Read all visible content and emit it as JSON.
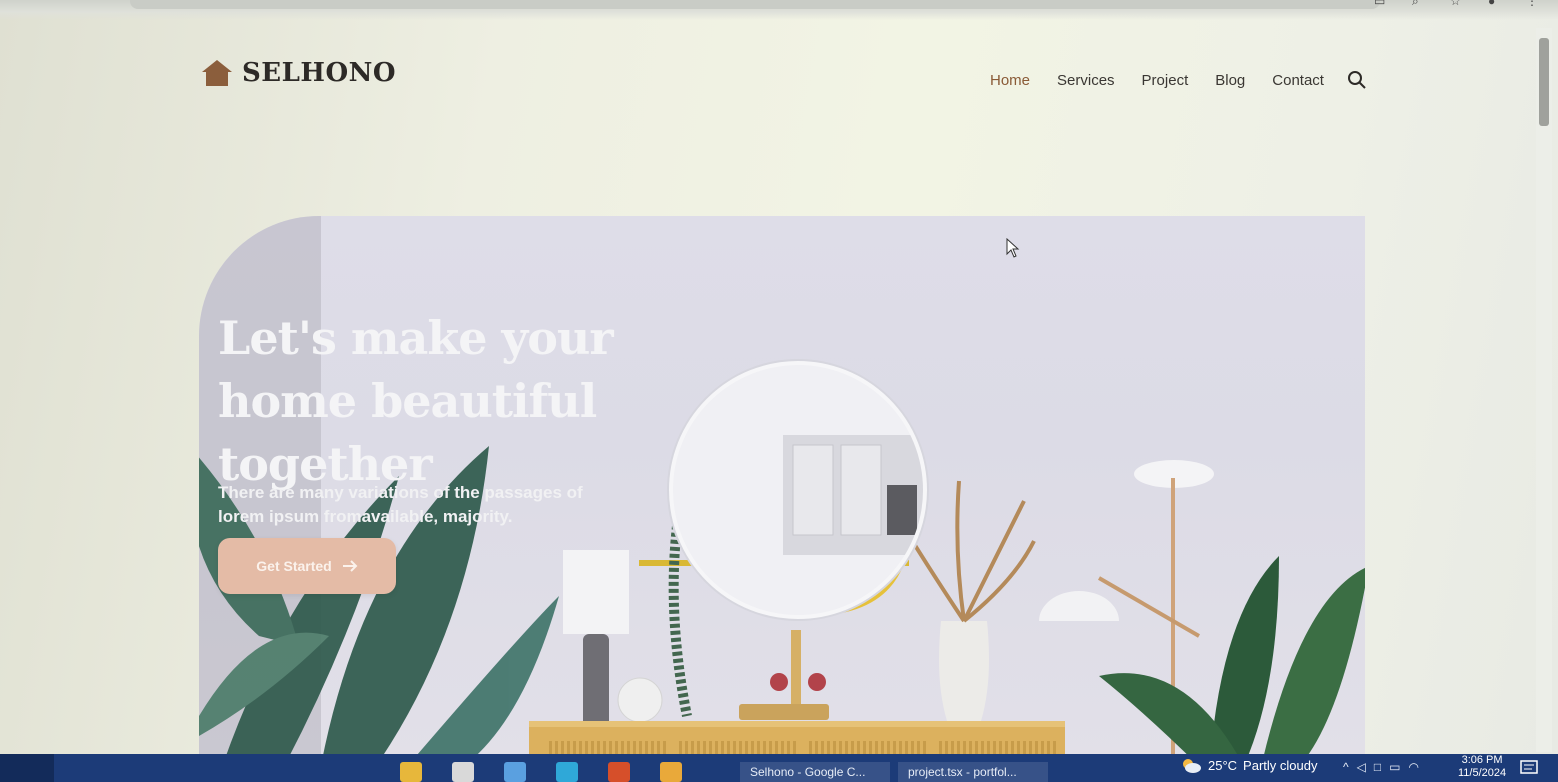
{
  "brand": {
    "name": "SELHONO",
    "logo_icon": "house-icon",
    "logo_color": "#8b5e3c"
  },
  "nav": {
    "items": [
      {
        "label": "Home",
        "active": true
      },
      {
        "label": "Services",
        "active": false
      },
      {
        "label": "Project",
        "active": false
      },
      {
        "label": "Blog",
        "active": false
      },
      {
        "label": "Contact",
        "active": false
      }
    ],
    "search_icon": "search-icon"
  },
  "hero": {
    "title": "Let's make your home beautiful together",
    "subtitle": "There are many variations of the passages of lorem ipsum fromavailable, majority.",
    "cta_label": "Get Started",
    "cta_icon": "arrow-right-icon",
    "cta_color": "#e4bba6"
  },
  "taskbar": {
    "items": [
      {
        "label": "Selhono - Google C..."
      },
      {
        "label": "project.tsx - portfol..."
      }
    ],
    "weather": {
      "temp": "25°C",
      "condition": "Partly cloudy"
    },
    "time": "3:06 PM",
    "date": "11/5/2024"
  },
  "colors": {
    "accent": "#8a5a36",
    "text": "#2d2a27",
    "taskbar": "#1c3b78"
  }
}
